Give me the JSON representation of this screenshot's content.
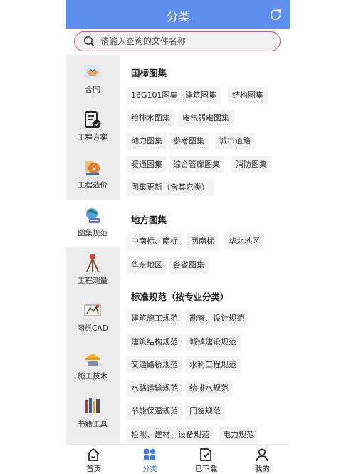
{
  "header": {
    "title": "分类"
  },
  "search": {
    "placeholder": "请输入查询的文件名称"
  },
  "sidebar": {
    "items": [
      {
        "label": "合同",
        "icon": "handshake-icon"
      },
      {
        "label": "工程方案",
        "icon": "document-check-icon"
      },
      {
        "label": "工程造价",
        "icon": "cost-icon"
      },
      {
        "label": "图集规范",
        "icon": "atlas-icon",
        "active": true
      },
      {
        "label": "工程测量",
        "icon": "survey-tripod-icon"
      },
      {
        "label": "图纸CAD",
        "icon": "cad-drawing-icon"
      },
      {
        "label": "施工技术",
        "icon": "construction-icon"
      },
      {
        "label": "书籍工具",
        "icon": "books-icon"
      }
    ]
  },
  "sections": [
    {
      "title": "国标图集",
      "tags": [
        "16G101图集",
        "建筑图集",
        "结构图集",
        "给排水图集",
        "电气弱电图集",
        "动力图集",
        "参考图集",
        "城市道路",
        "暖通图集",
        "综合管廊图集",
        "消防图集",
        "图集更新（含其它类）"
      ]
    },
    {
      "title": "地方图集",
      "tags": [
        "中南标、南标",
        "西南标",
        "华北地区",
        "华东地区",
        "各省图集"
      ]
    },
    {
      "title": "标准规范（按专业分类）",
      "tags": [
        "建筑施工规范",
        "勘察、设计规范",
        "建筑结构规范",
        "城镇建设规范",
        "交通路桥规范",
        "水利工程规范",
        "水路运输规范",
        "给排水规范",
        "节能保温规范",
        "门窗规范",
        "检测、建材、设备规范",
        "电力规范"
      ]
    }
  ],
  "tabbar": {
    "items": [
      {
        "label": "首页",
        "icon": "home-icon"
      },
      {
        "label": "分类",
        "icon": "category-icon",
        "active": true
      },
      {
        "label": "已下载",
        "icon": "downloaded-icon"
      },
      {
        "label": "我的",
        "icon": "profile-icon"
      }
    ]
  },
  "colors": {
    "header": "#5d8ef0",
    "accent": "#3c7cf0",
    "search_border": "#d45a5a"
  }
}
